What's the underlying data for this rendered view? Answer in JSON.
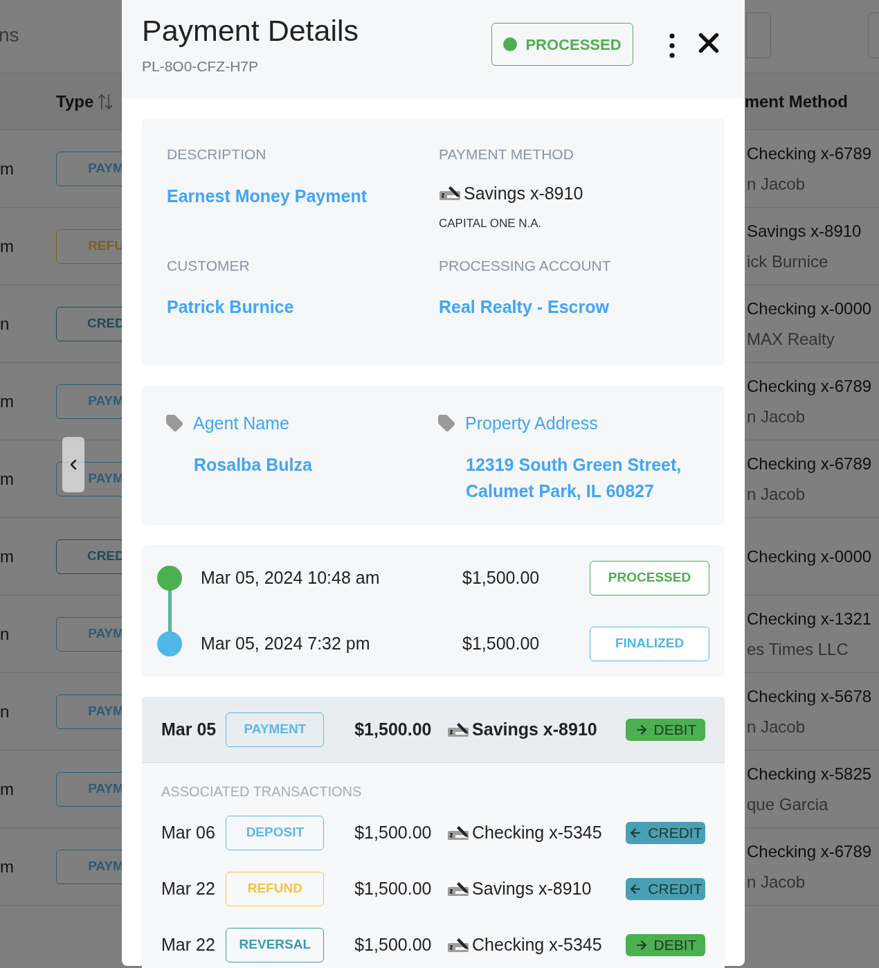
{
  "background": {
    "search_text": "ns",
    "columns": [
      {
        "label": "Type",
        "sortable": true
      },
      {
        "label": "ment Method"
      }
    ],
    "rows": [
      {
        "time": "m",
        "type": {
          "label": "PAYM",
          "kind": "payment"
        },
        "method": "Checking x-6789",
        "name": "n Jacob"
      },
      {
        "time": "m",
        "type": {
          "label": "REFU",
          "kind": "refund"
        },
        "method": "Savings x-8910",
        "name": "ick Burnice"
      },
      {
        "time": "n",
        "type": {
          "label": "CRED",
          "kind": "reversal"
        },
        "method": "Checking x-0000",
        "name": "MAX Realty"
      },
      {
        "time": "m",
        "type": {
          "label": "PAYM",
          "kind": "payment"
        },
        "method": "Checking x-6789",
        "name": "n Jacob"
      },
      {
        "time": "m",
        "type": {
          "label": "PAYM",
          "kind": "payment"
        },
        "method": "Checking x-6789",
        "name": "n Jacob"
      },
      {
        "time": "m",
        "type": {
          "label": "CRED",
          "kind": "reversal"
        },
        "method": "Checking x-0000"
      },
      {
        "time": "n",
        "type": {
          "label": "PAYM",
          "kind": "payment"
        },
        "method": "Checking x-1321",
        "name": "es Times LLC"
      },
      {
        "time": "n",
        "type": {
          "label": "PAYM",
          "kind": "payment"
        },
        "method": "Checking x-5678",
        "name": "n Jacob"
      },
      {
        "time": "m",
        "type": {
          "label": "PAYM",
          "kind": "payment"
        },
        "method": "Checking x-5825",
        "name": "que Garcia"
      },
      {
        "time": "m",
        "type": {
          "label": "PAYM",
          "kind": "payment"
        },
        "method": "Checking x-6789",
        "name": "n Jacob"
      }
    ]
  },
  "modal": {
    "title": "Payment Details",
    "id": "PL-8O0-CFZ-H7P",
    "status": {
      "label": "PROCESSED",
      "kind": "processed"
    },
    "details": [
      {
        "label": "DESCRIPTION",
        "value": "Earnest Money Payment",
        "kind": "link"
      },
      {
        "label": "PAYMENT METHOD",
        "value": "Savings x-8910",
        "sub": "CAPITAL ONE N.A.",
        "kind": "account"
      },
      {
        "label": "CUSTOMER",
        "value": "Patrick Burnice",
        "kind": "link"
      },
      {
        "label": "PROCESSING ACCOUNT",
        "value": "Real Realty - Escrow",
        "kind": "link"
      }
    ],
    "custom_fields": [
      {
        "label": "Agent Name",
        "value": "Rosalba Bulza"
      },
      {
        "label": "Property Address",
        "value": "12319 South Green Street, Calumet Park, IL 60827"
      }
    ],
    "timeline": [
      {
        "datetime": "Mar 05, 2024 10:48 am",
        "amount": "$1,500.00",
        "status": "PROCESSED",
        "kind": "processed",
        "color": "#4caf50"
      },
      {
        "datetime": "Mar 05, 2024 7:32 pm",
        "amount": "$1,500.00",
        "status": "FINALIZED",
        "kind": "finalized",
        "color": "#4fb8e8"
      }
    ],
    "transaction": {
      "date": "Mar 05",
      "type": {
        "label": "PAYMENT",
        "kind": "payment"
      },
      "amount": "$1,500.00",
      "account": "Savings x-8910",
      "direction": {
        "label": "DEBIT",
        "kind": "debit"
      }
    },
    "associated_title": "ASSOCIATED TRANSACTIONS",
    "associated": [
      {
        "date": "Mar 06",
        "type": {
          "label": "DEPOSIT",
          "kind": "payment"
        },
        "amount": "$1,500.00",
        "account": "Checking x-5345",
        "direction": {
          "label": "CREDIT",
          "kind": "credit"
        }
      },
      {
        "date": "Mar 22",
        "type": {
          "label": "REFUND",
          "kind": "refund"
        },
        "amount": "$1,500.00",
        "account": "Savings x-8910",
        "direction": {
          "label": "CREDIT",
          "kind": "credit"
        }
      },
      {
        "date": "Mar 22",
        "type": {
          "label": "REVERSAL",
          "kind": "reversal"
        },
        "amount": "$1,500.00",
        "account": "Checking x-5345",
        "direction": {
          "label": "DEBIT",
          "kind": "debit"
        }
      }
    ]
  }
}
